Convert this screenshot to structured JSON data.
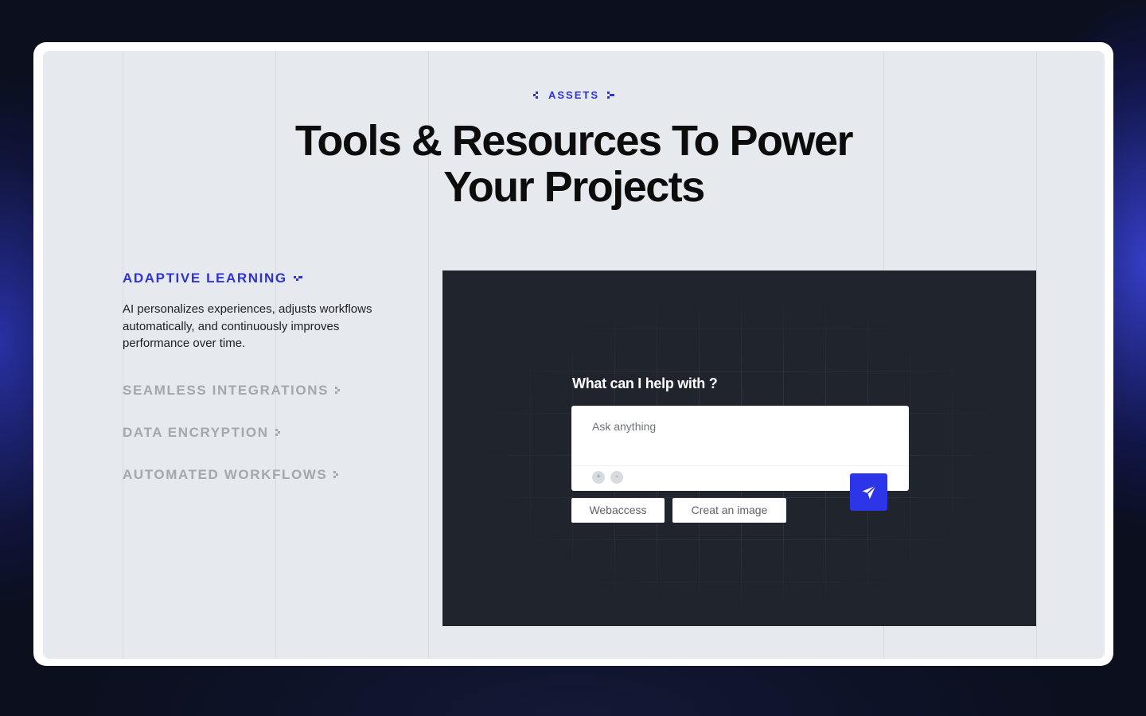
{
  "section": {
    "eyebrow": "ASSETS",
    "title_line1": "Tools & Resources To Power",
    "title_line2": "Your Projects"
  },
  "features": [
    {
      "title": "ADAPTIVE LEARNING",
      "active": true,
      "description": "AI personalizes experiences, adjusts workflows automatically, and continuously improves performance over time."
    },
    {
      "title": "SEAMLESS INTEGRATIONS",
      "active": false
    },
    {
      "title": "DATA ENCRYPTION",
      "active": false
    },
    {
      "title": "AUTOMATED WORKFLOWS",
      "active": false
    }
  ],
  "demo": {
    "question": "What can I help with ?",
    "input_placeholder": "Ask anything",
    "chips": [
      "Webaccess",
      "Creat an image"
    ],
    "icons": [
      "plus-icon",
      "globe-icon",
      "send-icon"
    ]
  },
  "colors": {
    "accent": "#2f33d6",
    "send_button": "#2d35e8",
    "demo_bg": "#20242d",
    "panel_bg": "#e6e9ed",
    "page_bg": "#0b0f1e"
  }
}
